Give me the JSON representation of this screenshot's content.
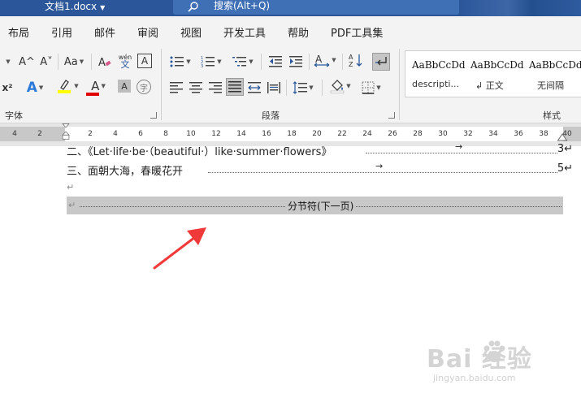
{
  "titlebar": {
    "doc_name": "文档1.docx",
    "search_text": "搜索(Alt+Q)"
  },
  "menu": {
    "tabs": [
      "布局",
      "引用",
      "邮件",
      "审阅",
      "视图",
      "开发工具",
      "帮助",
      "PDF工具集"
    ]
  },
  "ribbon": {
    "font_group_label": "字体",
    "paragraph_group_label": "段落",
    "styles_group_label": "样式",
    "font_grow": "A^",
    "font_shrink": "A˅",
    "change_case": "Aa",
    "phonetic_top": "wén",
    "phonetic_bottom": "文",
    "char_border": "A",
    "superscript": "x²",
    "text_effect": "A",
    "font_color": "A",
    "char_shading": "A",
    "enclose_char": "字",
    "styles": [
      {
        "sample": "AaBbCcDd",
        "name": "descripti..."
      },
      {
        "sample": "AaBbCcDd",
        "name": "↲ 正文"
      },
      {
        "sample": "AaBbCcDd",
        "name": "无间隔"
      }
    ]
  },
  "ruler": {
    "labels": [
      "4",
      "2",
      "2",
      "4",
      "6",
      "8",
      "10",
      "12",
      "14",
      "16",
      "18",
      "20",
      "22",
      "24",
      "26",
      "28",
      "30",
      "32",
      "34",
      "36",
      "38",
      "40"
    ]
  },
  "document": {
    "toc": [
      {
        "text": "二、《Let·life·be·（beautiful·）like·summer·flowers》",
        "page": "3↵"
      },
      {
        "text": "三、面朝大海，春暖花开",
        "page": "5↵"
      }
    ],
    "paragraph_mark": "↵",
    "section_break_label": "分节符(下一页)"
  },
  "watermark": {
    "brand": "Bai 经验",
    "url": "jingyan.baidu.com"
  },
  "colors": {
    "title_blue": "#2b579a",
    "highlight_yellow": "#ffff00",
    "font_red": "#e00000",
    "annotation_red": "#f03a3a"
  }
}
